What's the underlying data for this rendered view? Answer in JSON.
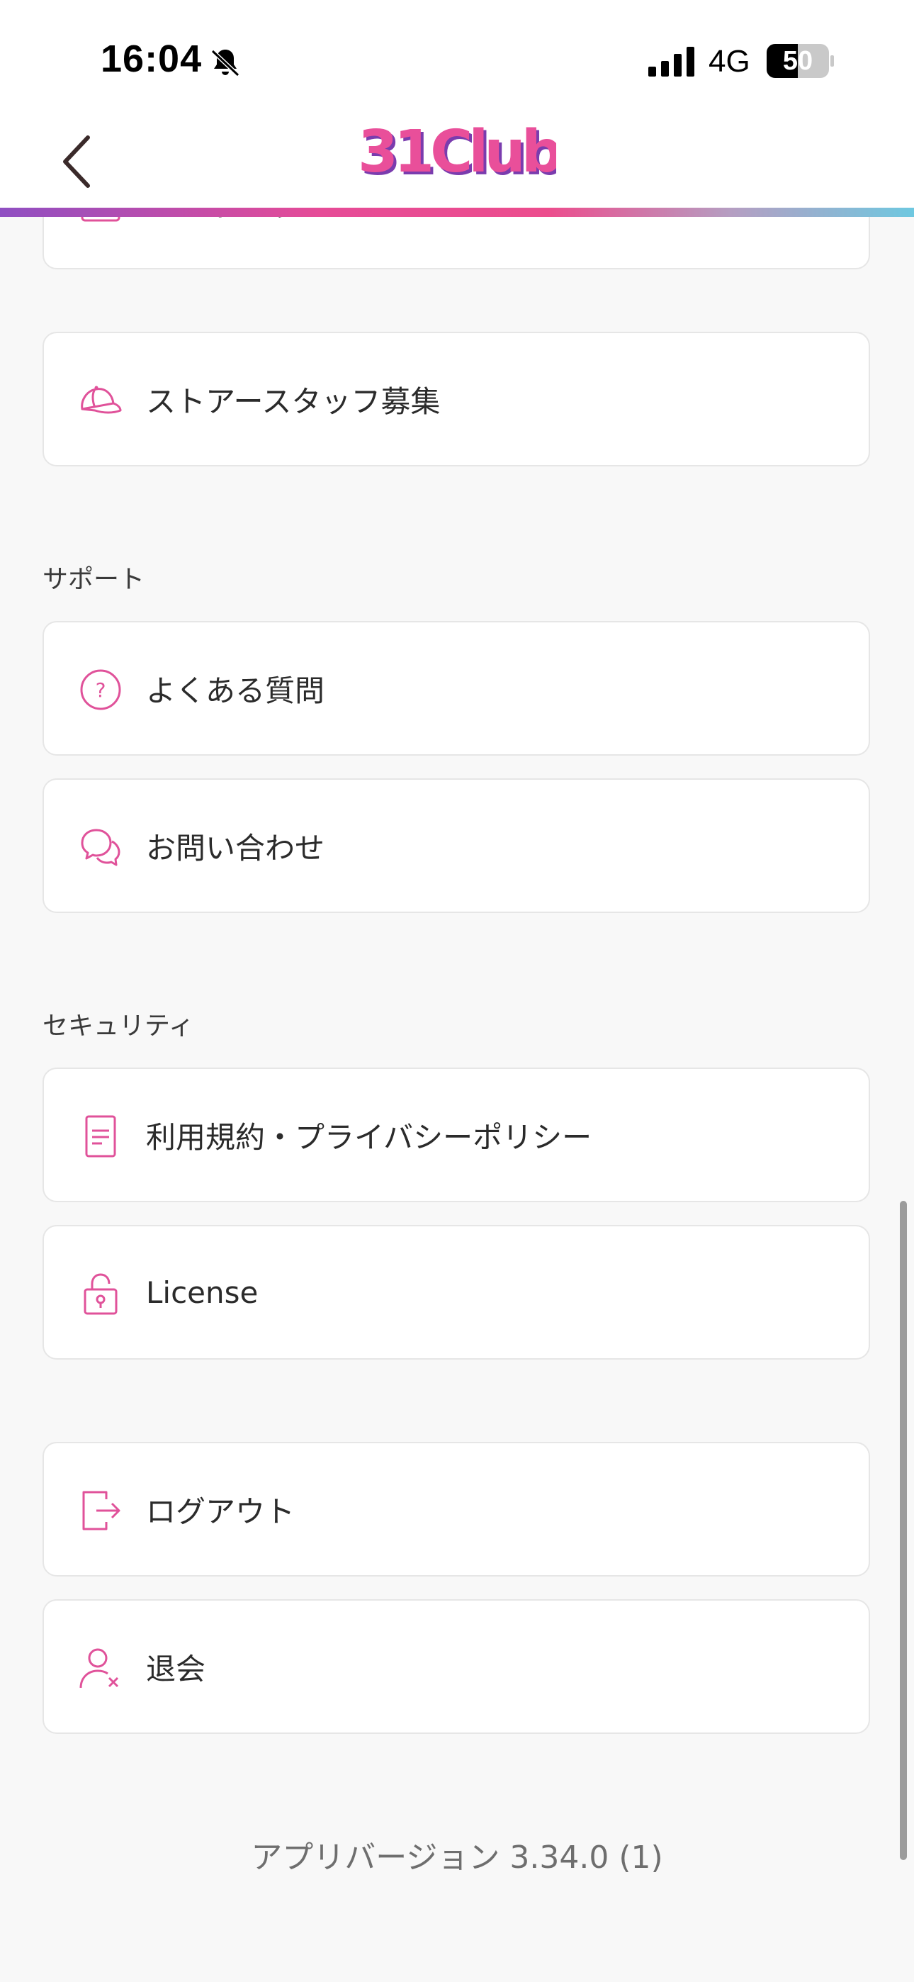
{
  "status_bar": {
    "time": "16:04",
    "network": "4G",
    "battery": "50"
  },
  "header": {
    "logo_text": "31Club"
  },
  "colors": {
    "accent": "#e0529a",
    "brand_pink": "#e94f9a",
    "brand_purple": "#7a3cae",
    "background": "#f8f8f8"
  },
  "items_top": [
    {
      "label": "オフィシャルサイト",
      "icon": "browser-window-icon"
    },
    {
      "label": "ストアースタッフ募集",
      "icon": "cap-icon"
    }
  ],
  "support": {
    "title": "サポート",
    "items": [
      {
        "label": "よくある質問",
        "icon": "question-circle-icon"
      },
      {
        "label": "お問い合わせ",
        "icon": "chat-bubbles-icon"
      }
    ]
  },
  "security": {
    "title": "セキュリティ",
    "items": [
      {
        "label": "利用規約・プライバシーポリシー",
        "icon": "document-icon"
      },
      {
        "label": "License",
        "icon": "lock-icon"
      }
    ]
  },
  "account": {
    "items": [
      {
        "label": "ログアウト",
        "icon": "logout-icon"
      },
      {
        "label": "退会",
        "icon": "user-remove-icon"
      }
    ]
  },
  "app_version": "アプリバージョン 3.34.0 (1)"
}
